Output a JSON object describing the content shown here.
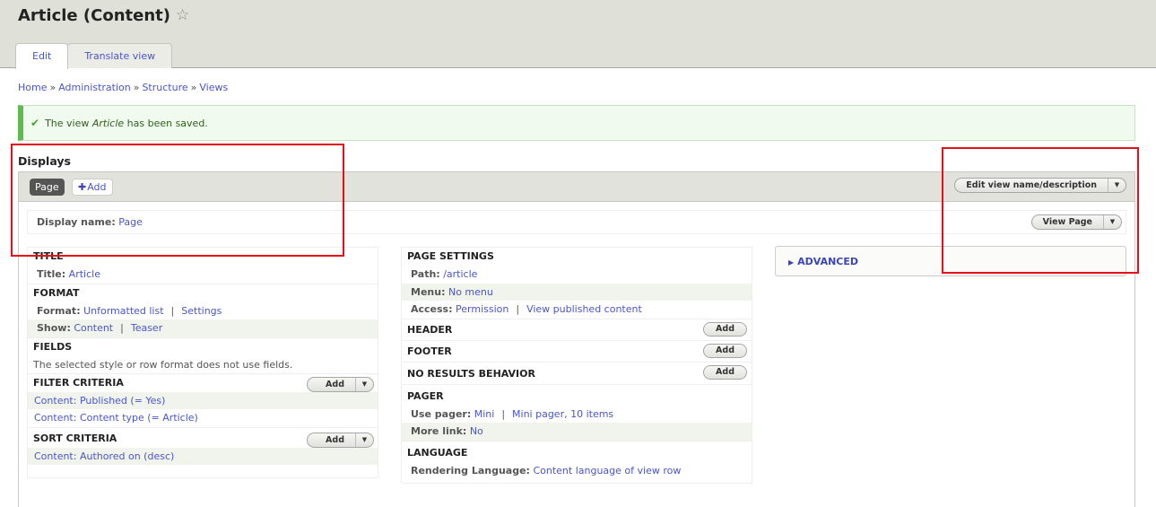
{
  "header": {
    "title": "Article (Content)",
    "star_icon": "☆",
    "tabs": [
      {
        "label": "Edit",
        "active": true
      },
      {
        "label": "Translate view",
        "active": false
      }
    ]
  },
  "breadcrumb": {
    "items": [
      "Home",
      "Administration",
      "Structure",
      "Views"
    ],
    "separator": "»"
  },
  "message": {
    "icon": "✔",
    "prefix": "The view ",
    "emphasis": "Article",
    "suffix": " has been saved."
  },
  "displays": {
    "title": "Displays",
    "active_tab": "Page",
    "add_label": "Add",
    "plus_icon": "✚",
    "edit_view_label": "Edit view name/description",
    "dropdown_icon": "▼",
    "display_name_label": "Display name:",
    "display_name_value": "Page",
    "view_page_label": "View Page"
  },
  "columns": {
    "first": {
      "title": {
        "heading": "TITLE",
        "label": "Title:",
        "value": "Article"
      },
      "format": {
        "heading": "FORMAT",
        "format_label": "Format:",
        "format_value": "Unformatted list",
        "format_settings": "Settings",
        "show_label": "Show:",
        "show_value": "Content",
        "show_mode": "Teaser"
      },
      "fields": {
        "heading": "FIELDS",
        "note": "The selected style or row format does not use fields."
      },
      "filter": {
        "heading": "FILTER CRITERIA",
        "add_label": "Add",
        "items": [
          "Content: Published (= Yes)",
          "Content: Content type (= Article)"
        ]
      },
      "sort": {
        "heading": "SORT CRITERIA",
        "add_label": "Add",
        "items": [
          "Content: Authored on (desc)"
        ]
      }
    },
    "second": {
      "page_settings": {
        "heading": "PAGE SETTINGS",
        "path_label": "Path:",
        "path_value": "/article",
        "menu_label": "Menu:",
        "menu_value": "No menu",
        "access_label": "Access:",
        "access_value": "Permission",
        "access_detail": "View published content"
      },
      "header": {
        "heading": "HEADER",
        "add_label": "Add"
      },
      "footer": {
        "heading": "FOOTER",
        "add_label": "Add"
      },
      "no_results": {
        "heading": "NO RESULTS BEHAVIOR",
        "add_label": "Add"
      },
      "pager": {
        "heading": "PAGER",
        "use_label": "Use pager:",
        "use_value": "Mini",
        "use_detail": "Mini pager, 10 items",
        "more_label": "More link:",
        "more_value": "No"
      },
      "language": {
        "heading": "LANGUAGE",
        "label": "Rendering Language:",
        "value": "Content language of view row"
      }
    },
    "third": {
      "advanced_icon": "▶",
      "advanced_label": "ADVANCED"
    }
  },
  "colors": {
    "link": "#4a55c9",
    "header_bg": "#dfe0d8",
    "success_border": "#5fbb50",
    "highlight": "#e3101a"
  }
}
